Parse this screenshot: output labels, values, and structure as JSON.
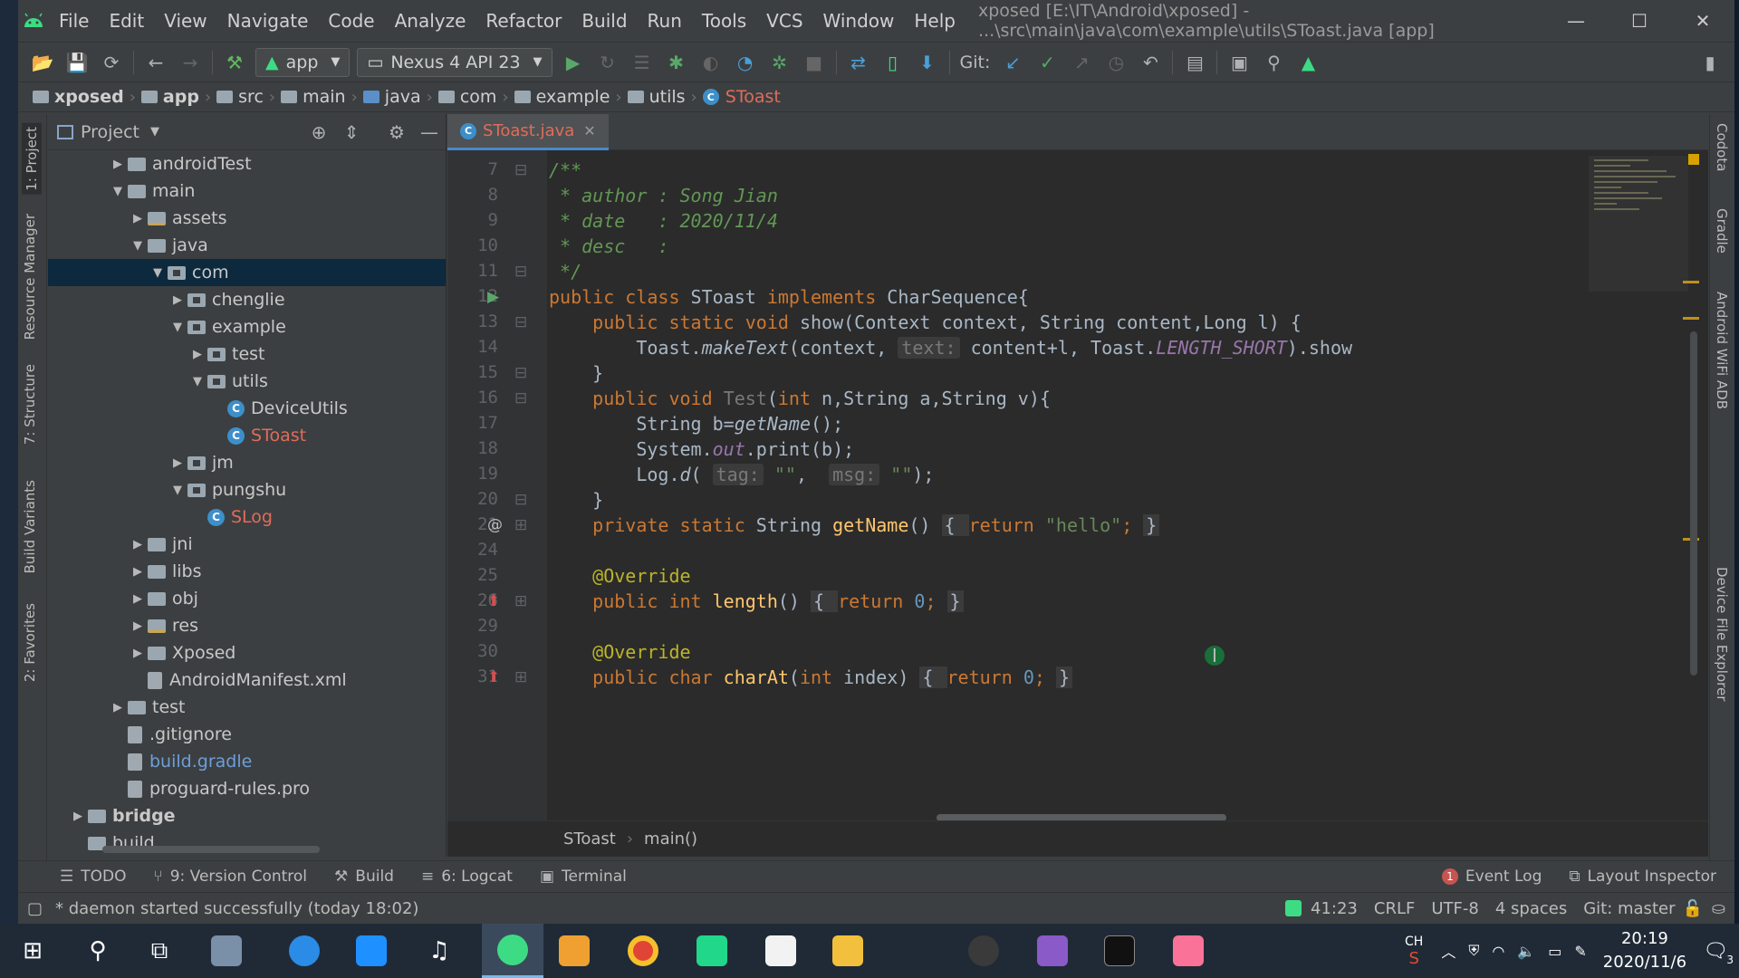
{
  "menubar": {
    "items": [
      "File",
      "Edit",
      "View",
      "Navigate",
      "Code",
      "Analyze",
      "Refactor",
      "Build",
      "Run",
      "Tools",
      "VCS",
      "Window",
      "Help"
    ],
    "title": "xposed [E:\\IT\\Android\\xposed] - ...\\src\\main\\java\\com\\example\\utils\\SToast.java [app]"
  },
  "toolbar": {
    "run_config": "app",
    "device": "Nexus 4 API 23",
    "git_label": "Git:"
  },
  "breadcrumbs": [
    "xposed",
    "app",
    "src",
    "main",
    "java",
    "com",
    "example",
    "utils",
    "SToast"
  ],
  "project_panel": {
    "title": "Project",
    "tree": [
      {
        "label": "androidTest",
        "depth": 3,
        "arrow": "▶",
        "type": "folder"
      },
      {
        "label": "main",
        "depth": 3,
        "arrow": "▼",
        "type": "folder"
      },
      {
        "label": "assets",
        "depth": 4,
        "arrow": "▶",
        "type": "res"
      },
      {
        "label": "java",
        "depth": 4,
        "arrow": "▼",
        "type": "folder"
      },
      {
        "label": "com",
        "depth": 5,
        "arrow": "▼",
        "type": "pkg",
        "selected": true
      },
      {
        "label": "chenglie",
        "depth": 6,
        "arrow": "▶",
        "type": "pkg"
      },
      {
        "label": "example",
        "depth": 6,
        "arrow": "▼",
        "type": "pkg"
      },
      {
        "label": "test",
        "depth": 7,
        "arrow": "▶",
        "type": "pkg"
      },
      {
        "label": "utils",
        "depth": 7,
        "arrow": "▼",
        "type": "pkg"
      },
      {
        "label": "DeviceUtils",
        "depth": 8,
        "arrow": "",
        "type": "class"
      },
      {
        "label": "SToast",
        "depth": 8,
        "arrow": "",
        "type": "class",
        "color": "red"
      },
      {
        "label": "jm",
        "depth": 6,
        "arrow": "▶",
        "type": "pkg"
      },
      {
        "label": "pungshu",
        "depth": 6,
        "arrow": "▼",
        "type": "pkg"
      },
      {
        "label": "SLog",
        "depth": 7,
        "arrow": "",
        "type": "class",
        "color": "red"
      },
      {
        "label": "jni",
        "depth": 4,
        "arrow": "▶",
        "type": "folder"
      },
      {
        "label": "libs",
        "depth": 4,
        "arrow": "▶",
        "type": "folder"
      },
      {
        "label": "obj",
        "depth": 4,
        "arrow": "▶",
        "type": "folder"
      },
      {
        "label": "res",
        "depth": 4,
        "arrow": "▶",
        "type": "res"
      },
      {
        "label": "Xposed",
        "depth": 4,
        "arrow": "▶",
        "type": "folder"
      },
      {
        "label": "AndroidManifest.xml",
        "depth": 4,
        "arrow": "",
        "type": "file"
      },
      {
        "label": "test",
        "depth": 3,
        "arrow": "▶",
        "type": "folder"
      },
      {
        "label": ".gitignore",
        "depth": 3,
        "arrow": "",
        "type": "file"
      },
      {
        "label": "build.gradle",
        "depth": 3,
        "arrow": "",
        "type": "file",
        "color": "blue"
      },
      {
        "label": "proguard-rules.pro",
        "depth": 3,
        "arrow": "",
        "type": "file"
      },
      {
        "label": "bridge",
        "depth": 1,
        "arrow": "▶",
        "type": "folder",
        "bold": true
      },
      {
        "label": "build",
        "depth": 1,
        "arrow": "",
        "type": "folder"
      }
    ]
  },
  "left_stripe": [
    "1: Project",
    "Resource Manager",
    "7: Structure",
    "Build Variants",
    "2: Favorites"
  ],
  "right_stripe": [
    "Codota",
    "Gradle",
    "Android WiFi ADB",
    "Device File Explorer"
  ],
  "editor": {
    "tab": "SToast.java",
    "line_numbers": [
      "7",
      "8",
      "9",
      "10",
      "11",
      "12",
      "13",
      "14",
      "15",
      "16",
      "17",
      "18",
      "19",
      "20",
      "21",
      "24",
      "25",
      "26",
      "29",
      "30",
      "31"
    ],
    "breadcrumb": [
      "SToast",
      "main()"
    ],
    "code": {
      "l7": "/**",
      "l8": " * author : Song Jian",
      "l9": " * date   : 2020/11/4",
      "l10": " * desc   :",
      "l11": " */",
      "l12_kw": "public class ",
      "l12_name": "SToast ",
      "l12_kw2": "implements ",
      "l12_rest": "CharSequence{",
      "l13_kw": "    public static void ",
      "l13_fn": "show",
      "l13_rest": "(Context context, String content,Long l) {",
      "l14_a": "        Toast.",
      "l14_fn": "makeText",
      "l14_b": "(context, ",
      "l14_hint": "text:",
      "l14_c": " content+l, Toast.",
      "l14_const": "LENGTH_SHORT",
      "l14_d": ").show",
      "l15": "    }",
      "l16_kw": "    public void ",
      "l16_fn": "Test",
      "l16_a": "(",
      "l16_kw2": "int ",
      "l16_rest": "n,String a,String v){",
      "l17_a": "        String b=",
      "l17_fn": "getName",
      "l17_b": "();",
      "l18_a": "        System.",
      "l18_out": "out",
      "l18_b": ".print(b);",
      "l19_a": "        Log.",
      "l19_fn": "d",
      "l19_b": "( ",
      "l19_hint1": "tag:",
      "l19_s1": " \"\"",
      "l19_c": ",  ",
      "l19_hint2": "msg:",
      "l19_s2": " \"\"",
      "l19_d": ");",
      "l20": "    }",
      "l21_kw": "    private static ",
      "l21_a": "String ",
      "l21_fn": "getName",
      "l21_b": "() ",
      "l21_ob": "{ ",
      "l21_kw2": "return ",
      "l21_s": "\"hello\"",
      "l21_sc": "; ",
      "l21_cb": "}",
      "l24": "",
      "l25": "    @Override",
      "l26_kw": "    public int ",
      "l26_fn": "length",
      "l26_b": "() ",
      "l26_ob": "{ ",
      "l26_kw2": "return ",
      "l26_n": "0",
      "l26_sc": "; ",
      "l26_cb": "}",
      "l29": "",
      "l30": "    @Override",
      "l31_kw": "    public char ",
      "l31_fn": "charAt",
      "l31_a": "(",
      "l31_kw2": "int ",
      "l31_b": "index) ",
      "l31_ob": "{ ",
      "l31_kw3": "return ",
      "l31_n": "0",
      "l31_sc": "; ",
      "l31_cb": "}"
    }
  },
  "bottom_tools": {
    "todo": "TODO",
    "vcs": "9: Version Control",
    "build": "Build",
    "logcat": "6: Logcat",
    "terminal": "Terminal",
    "event_log": "Event Log",
    "event_count": "1",
    "layout_inspector": "Layout Inspector"
  },
  "status": {
    "message": "* daemon started successfully (today 18:02)",
    "position": "41:23",
    "line_sep": "CRLF",
    "encoding": "UTF-8",
    "indent": "4 spaces",
    "git": "Git: master"
  },
  "taskbar": {
    "ime": "CH",
    "time": "20:19",
    "date": "2020/11/6",
    "notif_count": "3"
  },
  "colors": {
    "accent": "#4a88c7",
    "keyword": "#cc7832",
    "comment": "#629755",
    "string": "#6a8759",
    "function": "#ffc66d"
  }
}
